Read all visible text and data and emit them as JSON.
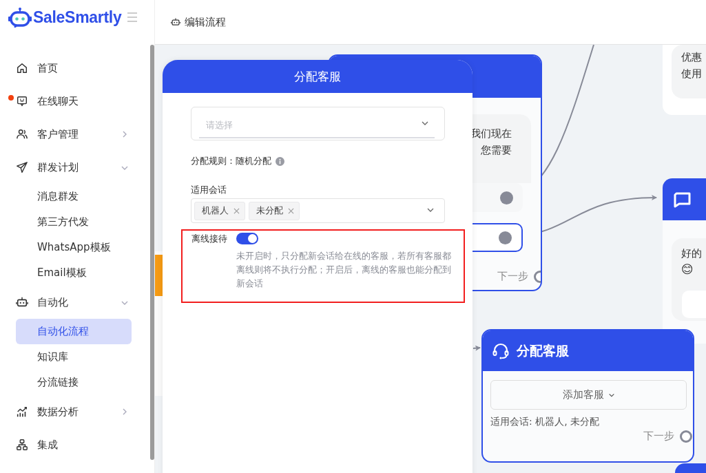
{
  "brand": {
    "name": "SaleSmartly"
  },
  "header": {
    "title": "编辑流程"
  },
  "sidebar": {
    "items": [
      {
        "label": "首页",
        "kind": "link",
        "unread": false
      },
      {
        "label": "在线聊天",
        "kind": "link",
        "unread": true
      },
      {
        "label": "客户管理",
        "kind": "group",
        "unread": false,
        "expanded": false
      },
      {
        "label": "群发计划",
        "kind": "group",
        "unread": false,
        "expanded": true,
        "children": [
          {
            "label": "消息群发",
            "selected": false
          },
          {
            "label": "第三方代发",
            "selected": false
          },
          {
            "label": "WhatsApp模板",
            "selected": false
          },
          {
            "label": "Email模板",
            "selected": false
          }
        ]
      },
      {
        "label": "自动化",
        "kind": "group",
        "unread": false,
        "expanded": true,
        "children": [
          {
            "label": "自动化流程",
            "selected": true
          },
          {
            "label": "知识库",
            "selected": false
          },
          {
            "label": "分流链接",
            "selected": false
          }
        ]
      },
      {
        "label": "数据分析",
        "kind": "group",
        "unread": false,
        "expanded": false
      },
      {
        "label": "集成",
        "kind": "link",
        "unread": false
      }
    ]
  },
  "canvas": {
    "nodes": [
      {
        "kind": "message",
        "lines": [
          "我们现在",
          "您需要"
        ],
        "next": "下一步"
      },
      {
        "kind": "card",
        "lines": [
          "优惠",
          "使用"
        ]
      },
      {
        "kind": "send",
        "lines": [
          "好的"
        ],
        "emoji": "😊"
      },
      {
        "kind": "assign",
        "title": "分配客服",
        "button": "添加客服",
        "info": "适用会话: 机器人, 未分配",
        "next": "下一步"
      }
    ]
  },
  "panel": {
    "title": "分配客服",
    "select": {
      "placeholder": "请选择"
    },
    "rule": "分配规则：随机分配",
    "sessions": {
      "label": "适用会话",
      "tags": [
        "机器人",
        "未分配"
      ]
    },
    "offline": {
      "label": "离线接待",
      "on": true,
      "highlighted": true,
      "description": "未开启时，只分配新会话给在线的客服，若所有客服都离线则将不执行分配；开启后，离线的客服也能分配到新会话"
    }
  }
}
